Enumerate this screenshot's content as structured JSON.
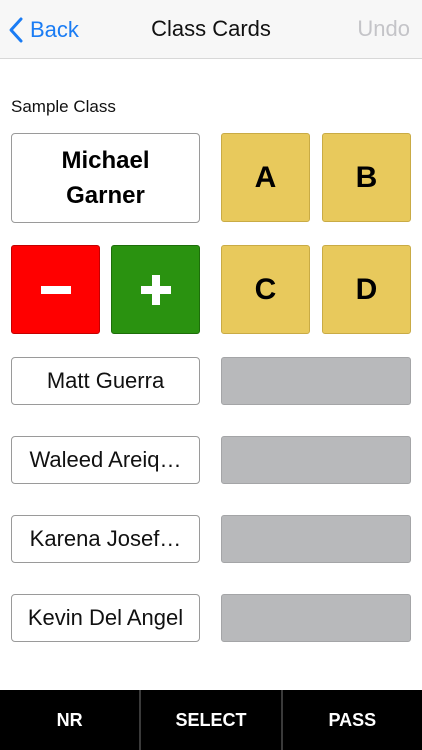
{
  "navbar": {
    "back_label": "Back",
    "title": "Class Cards",
    "undo_label": "Undo"
  },
  "class_name": "Sample Class",
  "current_student": {
    "first_name": "Michael",
    "last_name": "Garner"
  },
  "answers": [
    "A",
    "B",
    "C",
    "D"
  ],
  "students": [
    "Matt Guerra",
    "Waleed Areiq…",
    "Karena Josef…",
    "Kevin Del Angel"
  ],
  "toolbar": {
    "nr_label": "NR",
    "select_label": "SELECT",
    "pass_label": "PASS"
  },
  "colors": {
    "accent": "#1a7cf4",
    "answer_yellow": "#e8c95c",
    "minus_red": "#ff0000",
    "plus_green": "#2a9210",
    "empty_slot": "#b8b9bb"
  }
}
